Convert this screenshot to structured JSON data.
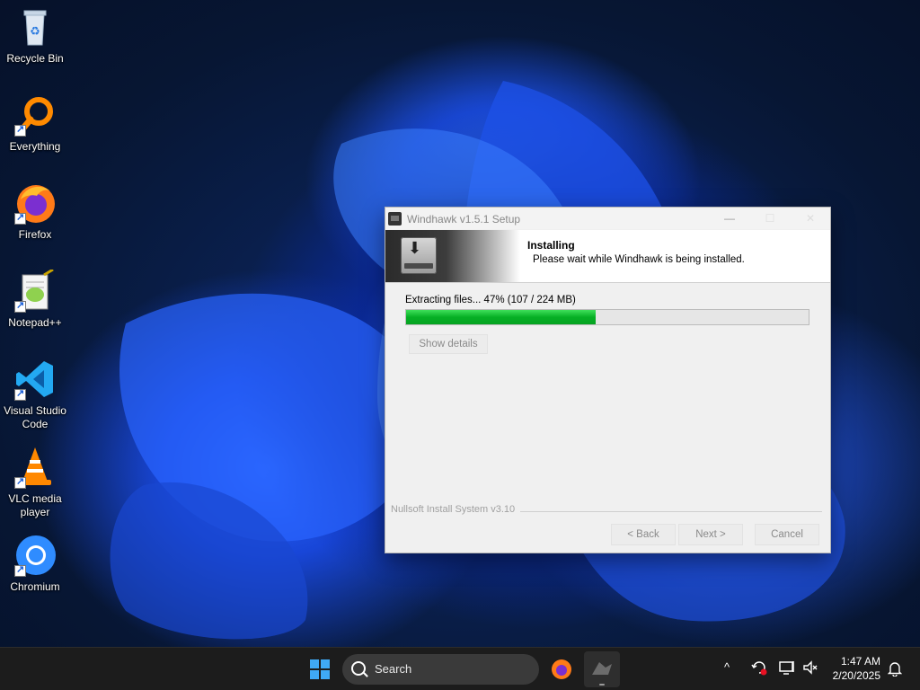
{
  "desktop": {
    "icons": [
      {
        "label": "Recycle Bin"
      },
      {
        "label": "Everything"
      },
      {
        "label": "Firefox"
      },
      {
        "label": "Notepad++"
      },
      {
        "label": "Visual Studio Code"
      },
      {
        "label": "VLC media player"
      },
      {
        "label": "Chromium"
      }
    ]
  },
  "window": {
    "title": "Windhawk v1.5.1 Setup",
    "minimize_glyph": "—",
    "maximize_glyph": "☐",
    "close_glyph": "✕",
    "header_title": "Installing",
    "header_subtitle": "Please wait while Windhawk is being installed.",
    "status_text": "Extracting files... 47% (107 / 224 MB)",
    "progress": 0.47,
    "show_details_label": "Show details",
    "branding": "Nullsoft Install System v3.10",
    "back_label": "< Back",
    "next_label": "Next >",
    "cancel_label": "Cancel"
  },
  "taskbar": {
    "search_placeholder": "Search",
    "time": "1:47 AM",
    "date": "2/20/2025",
    "icons": [
      "start-icon",
      "search-icon",
      "firefox-icon",
      "windhawk-icon",
      "chevron-up-icon",
      "update-icon",
      "network-icon",
      "volume-muted-icon",
      "notification-bell-icon"
    ]
  },
  "colors": {
    "progress_green": "#06b025",
    "taskbar_bg": "#1c1c1c"
  }
}
